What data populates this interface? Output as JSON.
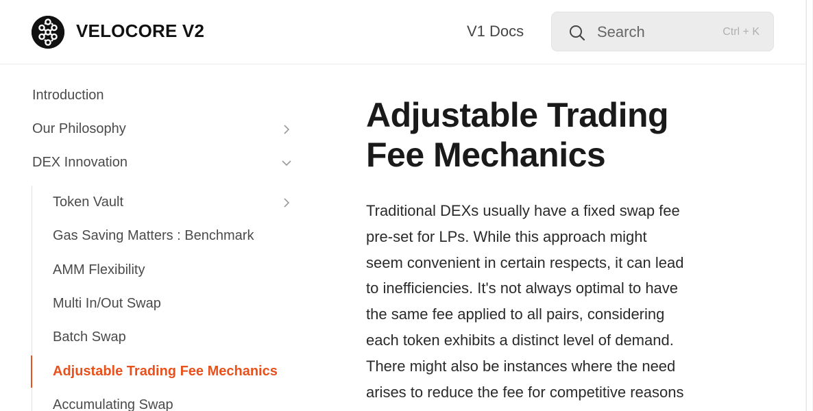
{
  "header": {
    "brand": "VELOCORE V2",
    "nav_link": "V1 Docs",
    "search": {
      "placeholder": "Search",
      "shortcut": "Ctrl + K"
    }
  },
  "sidebar": {
    "items": [
      {
        "label": "Introduction"
      },
      {
        "label": "Our Philosophy"
      },
      {
        "label": "DEX Innovation"
      }
    ],
    "sub_items": [
      {
        "label": "Token Vault"
      },
      {
        "label": "Gas Saving Matters : Benchmark"
      },
      {
        "label": "AMM Flexibility"
      },
      {
        "label": "Multi In/Out Swap"
      },
      {
        "label": "Batch Swap"
      },
      {
        "label": "Adjustable Trading Fee Mechanics"
      },
      {
        "label": "Accumulating Swap"
      }
    ]
  },
  "main": {
    "title_line1": "Adjustable Trading",
    "title_line2": "Fee Mechanics",
    "paragraph_lines": [
      "Traditional DEXs usually have a fixed swap fee",
      "pre-set for LPs. While this approach might",
      "seem convenient in certain respects, it can lead",
      "to inefficiencies. It's not always optimal to have",
      "the same fee applied to all pairs, considering",
      "each token exhibits a distinct level of demand.",
      "There might also be instances where the need",
      "arises to reduce the fee for competitive reasons"
    ]
  },
  "colors": {
    "accent": "#e8501c",
    "text": "#4a4a4a",
    "heading": "#1a1a1a"
  }
}
